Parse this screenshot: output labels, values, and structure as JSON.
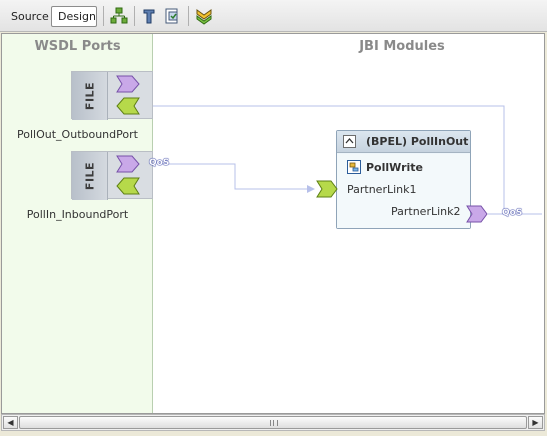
{
  "toolbar": {
    "tabs": [
      "Source",
      "Design"
    ],
    "buttons": [
      "layout-icon",
      "test-icon",
      "deploy-icon",
      "expand-all-icon"
    ]
  },
  "canvas": {
    "wsdl_title": "WSDL Ports",
    "jbi_title": "JBI Modules",
    "ports": [
      {
        "type_label": "FILE",
        "name": "PollOut_OutboundPort"
      },
      {
        "type_label": "FILE",
        "name": "PollIn_InboundPort",
        "badge": "QoS"
      }
    ],
    "module": {
      "title": "(BPEL) PollInOut",
      "process": "PollWrite",
      "links": [
        "PartnerLink1",
        "PartnerLink2"
      ],
      "badge": "QoS"
    }
  },
  "colors": {
    "wsdl_column": "#f2fbeb",
    "provide_arrow": "#c9a8e8",
    "consume_arrow": "#b6d94a",
    "connection": "#b7c0ea"
  }
}
